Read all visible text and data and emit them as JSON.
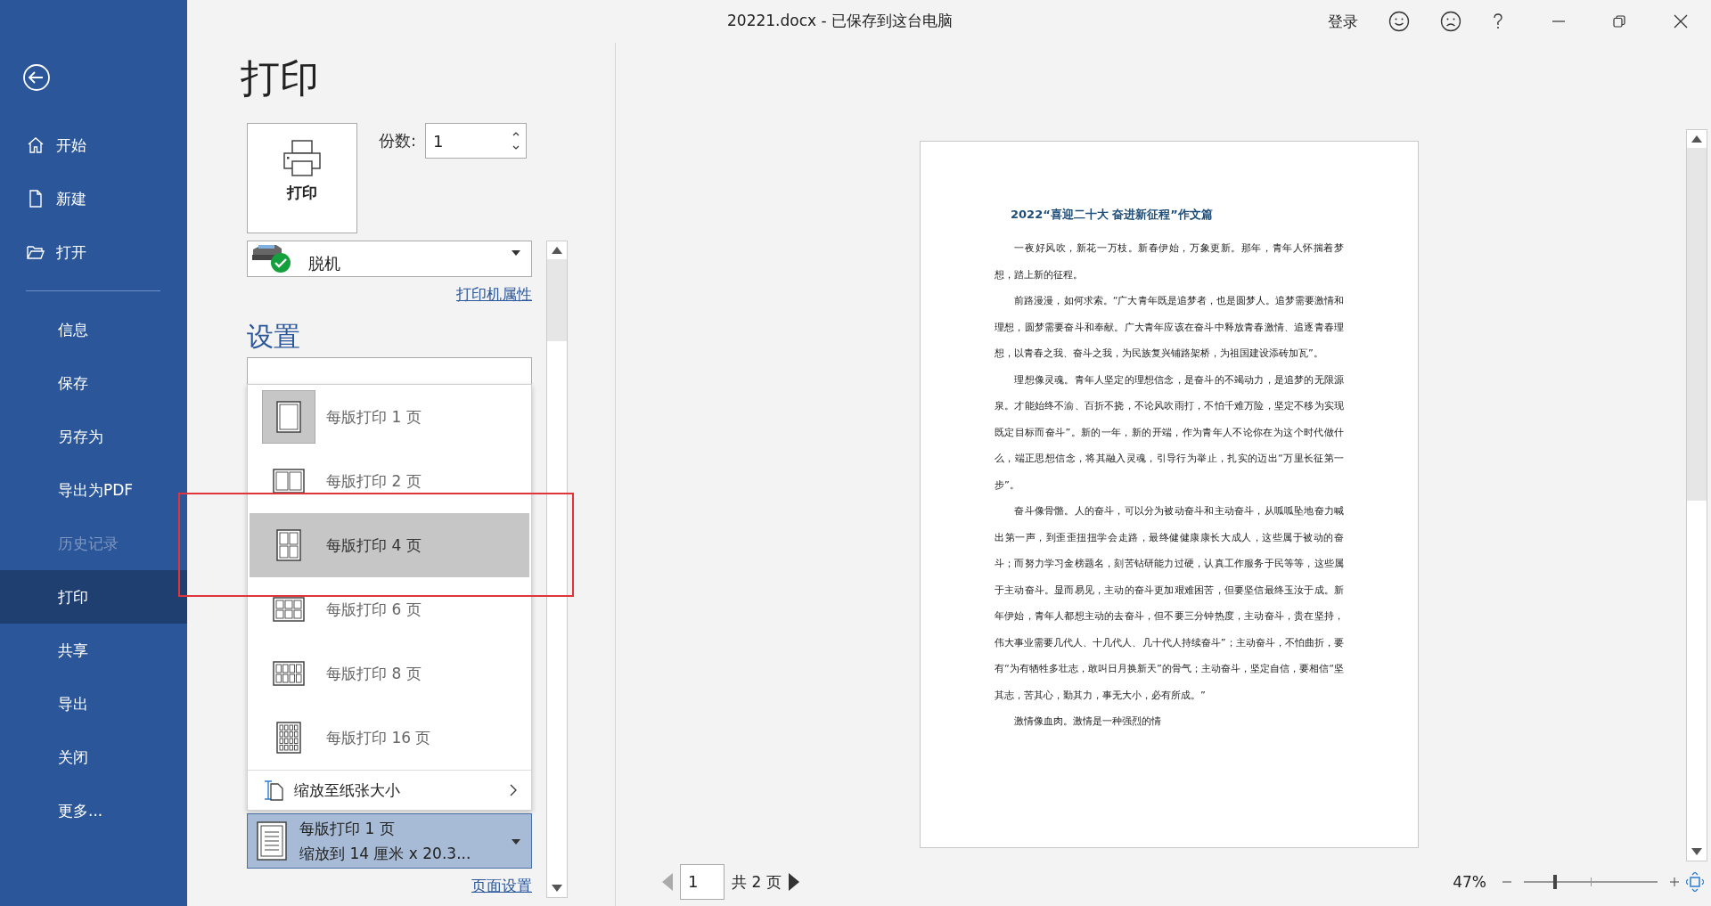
{
  "window": {
    "title": "20221.docx  -  已保存到这台电脑",
    "sign_in": "登录"
  },
  "sidebar": {
    "top_items": [
      {
        "label": "开始",
        "kind": "home"
      },
      {
        "label": "新建",
        "kind": "new"
      },
      {
        "label": "打开",
        "kind": "open"
      }
    ],
    "items": [
      {
        "label": "信息",
        "selected": false,
        "disabled": false
      },
      {
        "label": "保存",
        "selected": false,
        "disabled": false
      },
      {
        "label": "另存为",
        "selected": false,
        "disabled": false
      },
      {
        "label": "导出为PDF",
        "selected": false,
        "disabled": false
      },
      {
        "label": "历史记录",
        "selected": false,
        "disabled": true
      },
      {
        "label": "打印",
        "selected": true,
        "disabled": false
      },
      {
        "label": "共享",
        "selected": false,
        "disabled": false
      },
      {
        "label": "导出",
        "selected": false,
        "disabled": false
      },
      {
        "label": "关闭",
        "selected": false,
        "disabled": false
      },
      {
        "label": "更多...",
        "selected": false,
        "disabled": false
      }
    ]
  },
  "print": {
    "heading": "打印",
    "button_label": "打印",
    "copies_label": "份数:",
    "copies_value": "1",
    "printer": "脱机",
    "printer_properties": "打印机属性",
    "settings_heading": "设置",
    "layout_menu": [
      {
        "label": "每版打印 1 页",
        "kind": "one",
        "selected": true,
        "highlighted": false
      },
      {
        "label": "每版打印 2 页",
        "kind": "two",
        "selected": false,
        "highlighted": false
      },
      {
        "label": "每版打印 4 页",
        "kind": "four",
        "selected": false,
        "highlighted": true
      },
      {
        "label": "每版打印 6 页",
        "kind": "six",
        "selected": false,
        "highlighted": false
      },
      {
        "label": "每版打印 8 页",
        "kind": "eight",
        "selected": false,
        "highlighted": false
      },
      {
        "label": "每版打印 16 页",
        "kind": "sixteen",
        "selected": false,
        "highlighted": false
      }
    ],
    "fit_item": "缩放至纸张大小",
    "current": {
      "line1": "每版打印 1 页",
      "line2": "缩放到 14 厘米 x 20.3..."
    },
    "page_setup": "页面设置"
  },
  "preview": {
    "document": {
      "title": "2022“喜迎二十大 奋进新征程”作文篇",
      "paragraphs": [
        "一夜好风吹，新花一万枝。新春伊始，万象更新。那年，青年人怀揣着梦想，踏上新的征程。",
        "前路漫漫，如何求索。“广大青年既是追梦者，也是圆梦人。追梦需要激情和理想，圆梦需要奋斗和奉献。广大青年应该在奋斗中释放青春激情、追逐青春理想，以青春之我、奋斗之我，为民族复兴铺路架桥，为祖国建设添砖加瓦”。",
        "理想像灵魂。青年人坚定的理想信念，是奋斗的不竭动力，是追梦的无限源泉。才能始终不渝、百折不挠，不论风吹雨打，不怕千难万险，坚定不移为实现既定目标而奋斗”。新的一年，新的开端，作为青年人不论你在为这个时代做什么，端正思想信念，将其融入灵魂，引导行为举止，扎实的迈出“万里长征第一步”。",
        "奋斗像骨骼。人的奋斗，可以分为被动奋斗和主动奋斗，从呱呱坠地奋力喊出第一声，到歪歪扭扭学会走路，最终健健康康长大成人，这些属于被动的奋斗；而努力学习金榜题名，刻苦钻研能力过硬，认真工作服务于民等等，这些属于主动奋斗。显而易见，主动的奋斗更加艰难困苦，但要坚信最终玉汝于成。新年伊始，青年人都想主动的去奋斗，但不要三分钟热度，主动奋斗，贵在坚持，伟大事业需要几代人、十几代人、几十代人持续奋斗”；主动奋斗，不怕曲折，要有“为有牺牲多壮志，敢叫日月换新天”的骨气；主动奋斗，坚定自信，要相信“坚其志，苦其心，勤其力，事无大小，必有所成。”",
        "激情像血肉。激情是一种强烈的情"
      ]
    },
    "page_field": "1",
    "page_total": "共 2 页",
    "zoom": "47%",
    "zoom_slider": {
      "level": 0.23
    }
  }
}
